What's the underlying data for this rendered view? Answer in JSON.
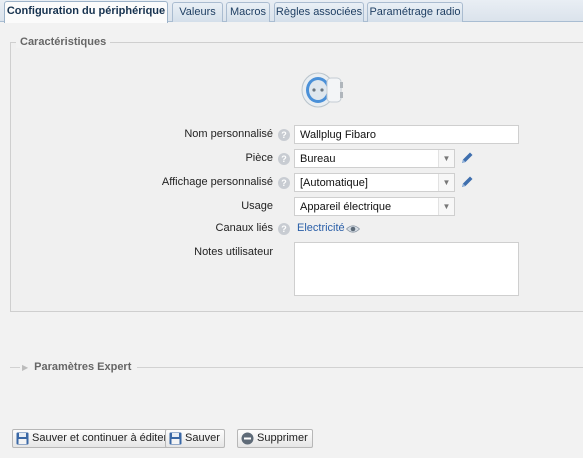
{
  "tabs": [
    {
      "label": "Configuration du périphérique"
    },
    {
      "label": "Valeurs"
    },
    {
      "label": "Macros"
    },
    {
      "label": "Règles associées"
    },
    {
      "label": "Paramétrage radio"
    }
  ],
  "characteristics": {
    "legend": "Caractéristiques",
    "device_image": "wall-plug-icon",
    "name": {
      "label": "Nom personnalisé",
      "value": "Wallplug Fibaro"
    },
    "room": {
      "label": "Pièce",
      "value": "Bureau"
    },
    "display": {
      "label": "Affichage personnalisé",
      "value": "[Automatique]"
    },
    "usage": {
      "label": "Usage",
      "value": "Appareil électrique"
    },
    "channels": {
      "label": "Canaux liés",
      "link": "Electricité"
    },
    "notes": {
      "label": "Notes utilisateur",
      "value": ""
    }
  },
  "expert": {
    "label": "Paramètres Expert"
  },
  "buttons": {
    "save_continue": "Sauver et continuer à éditer",
    "save": "Sauver",
    "delete": "Supprimer"
  },
  "colors": {
    "accent": "#2a5fa8",
    "tab_border": "#aabcd0"
  }
}
